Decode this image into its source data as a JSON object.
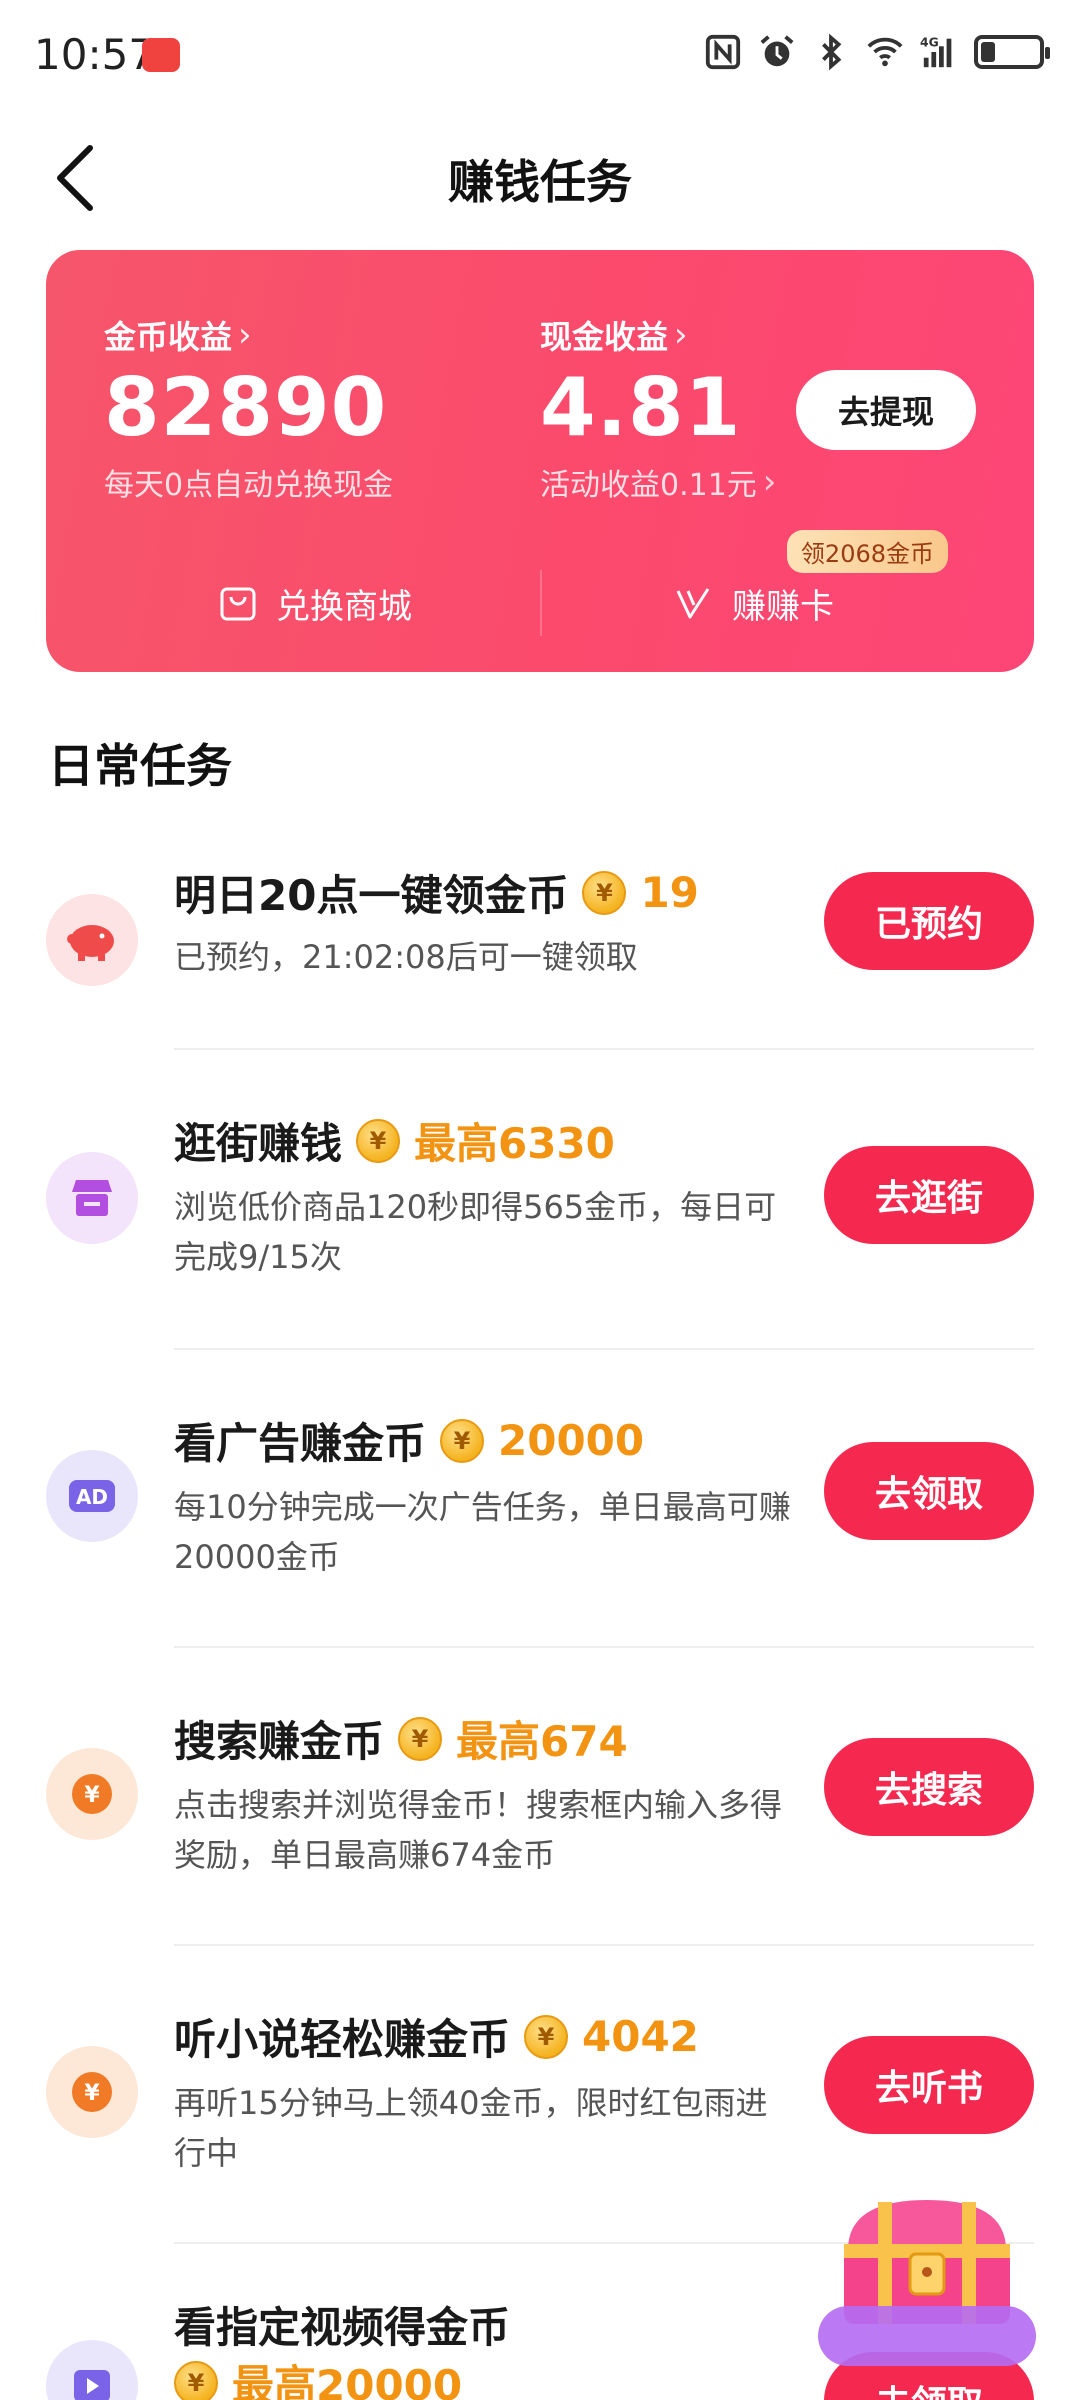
{
  "status_bar": {
    "time": "10:57",
    "network_label": "4G"
  },
  "header": {
    "title": "赚钱任务"
  },
  "wallet": {
    "coin_label": "金币收益",
    "coin_value": "82890",
    "coin_sub": "每天0点自动兑换现金",
    "cash_label": "现金收益",
    "cash_value": "4.81",
    "cash_sub": "活动收益0.11元",
    "withdraw_button": "去提现",
    "shop_link": "兑换商城",
    "earn_card_link": "赚赚卡",
    "earn_card_badge": "领2068金币",
    "colors": {
      "card_start": "#f6566b",
      "card_end": "#fd4677"
    }
  },
  "section": {
    "title": "日常任务"
  },
  "tasks": [
    {
      "title": "明日20点一键领金币",
      "reward": "19",
      "desc": "已预约，21:02:08后可一键领取",
      "button": "已预约",
      "icon": "piggy-bank-icon"
    },
    {
      "title": "逛街赚钱",
      "reward": "最高6330",
      "desc": "浏览低价商品120秒即得565金币，每日可完成9/15次",
      "button": "去逛街",
      "icon": "shop-icon"
    },
    {
      "title": "看广告赚金币",
      "reward": "20000",
      "desc": "每10分钟完成一次广告任务，单日最高可赚20000金币",
      "button": "去领取",
      "icon": "ad-icon"
    },
    {
      "title": "搜索赚金币",
      "reward": "最高674",
      "desc": "点击搜索并浏览得金币！搜索框内输入多得奖励，单日最高赚674金币",
      "button": "去搜索",
      "icon": "yuan-coin-icon"
    },
    {
      "title": "听小说轻松赚金币",
      "reward": "4042",
      "desc": "再听15分钟马上领40金币，限时红包雨进行中",
      "button": "去听书",
      "icon": "yuan-coin-icon"
    },
    {
      "title": "看指定视频得金币",
      "reward": "最高20000",
      "desc": "",
      "button": "去领取",
      "icon": "video-icon"
    }
  ],
  "accent_color": "#f5284f",
  "reward_color": "#f29312"
}
